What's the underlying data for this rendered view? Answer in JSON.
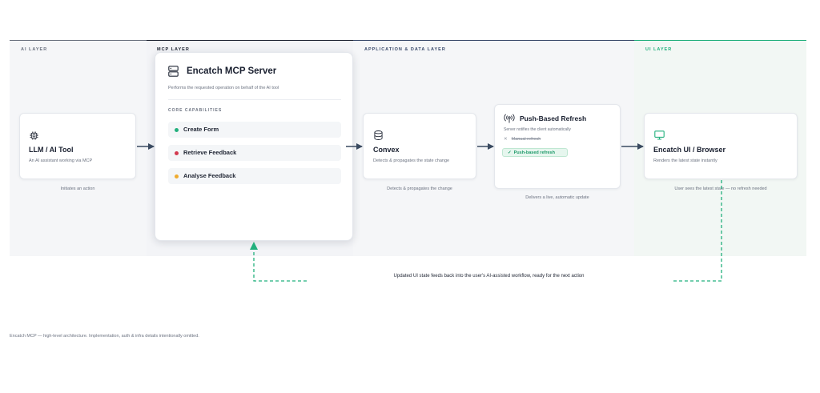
{
  "lanes": {
    "ai": {
      "label": "AI LAYER"
    },
    "mcp": {
      "label": "MCP LAYER"
    },
    "app": {
      "label": "APPLICATION & DATA LAYER"
    },
    "ui": {
      "label": "UI LAYER"
    }
  },
  "llm_card": {
    "title": "LLM / AI Tool",
    "description": "An AI assistant working via MCP",
    "caption": "Initiates an action",
    "icon": "chip-icon"
  },
  "mcp_card": {
    "title": "Encatch MCP Server",
    "description": "Performs the requested operation on behalf of the AI tool",
    "section_label": "CORE CAPABILITIES",
    "icon": "server-icon",
    "capabilities": [
      {
        "label": "Create Form",
        "color": "#22b07d"
      },
      {
        "label": "Retrieve Feedback",
        "color": "#d33a4f"
      },
      {
        "label": "Analyse Feedback",
        "color": "#f0ab2e"
      }
    ]
  },
  "convex_card": {
    "title": "Convex",
    "description": "Detects & propagates the state change",
    "caption": "Detects & propagates the change",
    "icon": "database-icon"
  },
  "push_card": {
    "title": "Push-Based Refresh",
    "description": "Server notifies the client automatically",
    "manual_label": "Manual refresh",
    "push_label": "Push-based refresh",
    "caption": "Delivers a live, automatic update",
    "icon": "broadcast-icon"
  },
  "ui_card": {
    "title": "Encatch UI / Browser",
    "description": "Renders the latest state instantly",
    "caption": "User sees the latest state — no refresh needed",
    "icon": "monitor-icon"
  },
  "feedback_loop": {
    "label": "Updated UI state feeds back into the user's AI-assisted workflow, ready for the next action"
  },
  "footer": {
    "note": "Encatch MCP — high-level architecture. Implementation, auth & infra details intentionally omitted."
  },
  "colors": {
    "neutral_bar": "#6b7280",
    "mcp_bar": "#1f2533",
    "app_bar": "#3a4a6b",
    "ui_bar": "#22b07d",
    "accent_green": "#22b07d",
    "arrow": "#3a4a60"
  }
}
